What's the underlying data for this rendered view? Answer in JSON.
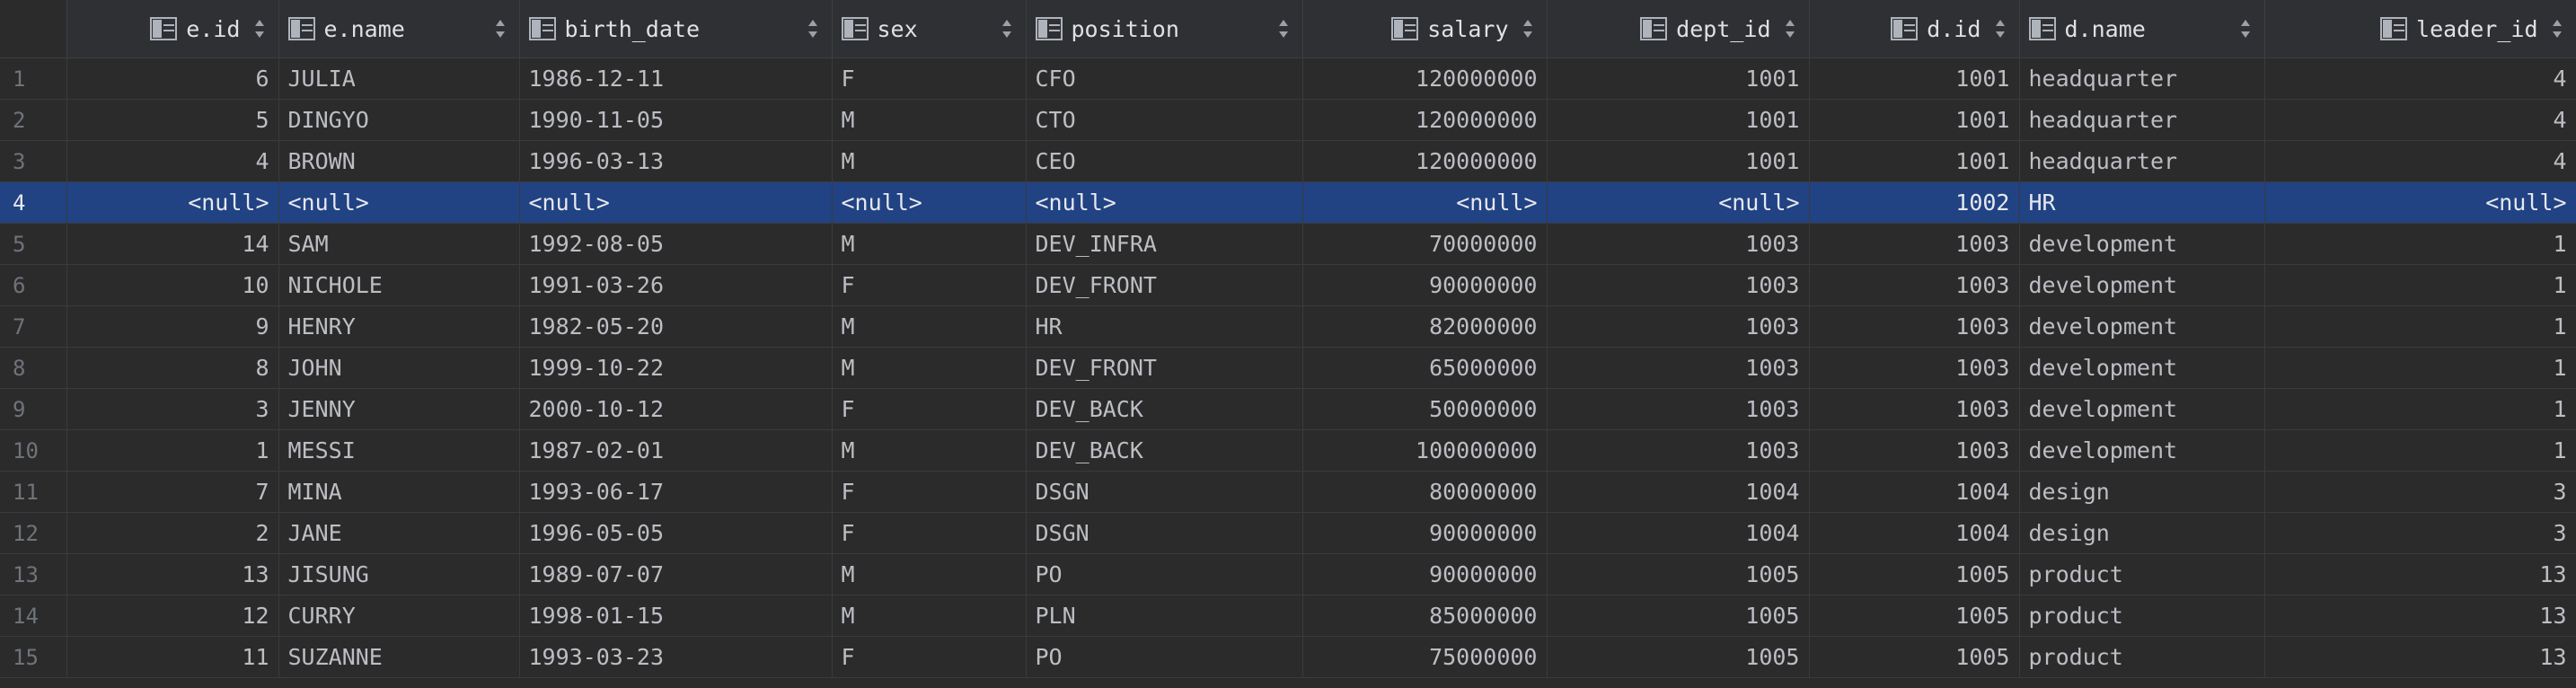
{
  "columns": [
    {
      "label": "e.id",
      "align": "right"
    },
    {
      "label": "e.name",
      "align": "left"
    },
    {
      "label": "birth_date",
      "align": "left"
    },
    {
      "label": "sex",
      "align": "left"
    },
    {
      "label": "position",
      "align": "left"
    },
    {
      "label": "salary",
      "align": "right"
    },
    {
      "label": "dept_id",
      "align": "right"
    },
    {
      "label": "d.id",
      "align": "right"
    },
    {
      "label": "d.name",
      "align": "left"
    },
    {
      "label": "leader_id",
      "align": "right"
    }
  ],
  "selected_row": 4,
  "rows": [
    {
      "n": "1",
      "cells": [
        "6",
        "JULIA",
        "1986-12-11",
        "F",
        "CFO",
        "120000000",
        "1001",
        "1001",
        "headquarter",
        "4"
      ]
    },
    {
      "n": "2",
      "cells": [
        "5",
        "DINGYO",
        "1990-11-05",
        "M",
        "CTO",
        "120000000",
        "1001",
        "1001",
        "headquarter",
        "4"
      ]
    },
    {
      "n": "3",
      "cells": [
        "4",
        "BROWN",
        "1996-03-13",
        "M",
        "CEO",
        "120000000",
        "1001",
        "1001",
        "headquarter",
        "4"
      ]
    },
    {
      "n": "4",
      "cells": [
        "<null>",
        "<null>",
        "<null>",
        "<null>",
        "<null>",
        "<null>",
        "<null>",
        "1002",
        "HR",
        "<null>"
      ]
    },
    {
      "n": "5",
      "cells": [
        "14",
        "SAM",
        "1992-08-05",
        "M",
        "DEV_INFRA",
        "70000000",
        "1003",
        "1003",
        "development",
        "1"
      ]
    },
    {
      "n": "6",
      "cells": [
        "10",
        "NICHOLE",
        "1991-03-26",
        "F",
        "DEV_FRONT",
        "90000000",
        "1003",
        "1003",
        "development",
        "1"
      ]
    },
    {
      "n": "7",
      "cells": [
        "9",
        "HENRY",
        "1982-05-20",
        "M",
        "HR",
        "82000000",
        "1003",
        "1003",
        "development",
        "1"
      ]
    },
    {
      "n": "8",
      "cells": [
        "8",
        "JOHN",
        "1999-10-22",
        "M",
        "DEV_FRONT",
        "65000000",
        "1003",
        "1003",
        "development",
        "1"
      ]
    },
    {
      "n": "9",
      "cells": [
        "3",
        "JENNY",
        "2000-10-12",
        "F",
        "DEV_BACK",
        "50000000",
        "1003",
        "1003",
        "development",
        "1"
      ]
    },
    {
      "n": "10",
      "cells": [
        "1",
        "MESSI",
        "1987-02-01",
        "M",
        "DEV_BACK",
        "100000000",
        "1003",
        "1003",
        "development",
        "1"
      ]
    },
    {
      "n": "11",
      "cells": [
        "7",
        "MINA",
        "1993-06-17",
        "F",
        "DSGN",
        "80000000",
        "1004",
        "1004",
        "design",
        "3"
      ]
    },
    {
      "n": "12",
      "cells": [
        "2",
        "JANE",
        "1996-05-05",
        "F",
        "DSGN",
        "90000000",
        "1004",
        "1004",
        "design",
        "3"
      ]
    },
    {
      "n": "13",
      "cells": [
        "13",
        "JISUNG",
        "1989-07-07",
        "M",
        "PO",
        "90000000",
        "1005",
        "1005",
        "product",
        "13"
      ]
    },
    {
      "n": "14",
      "cells": [
        "12",
        "CURRY",
        "1998-01-15",
        "M",
        "PLN",
        "85000000",
        "1005",
        "1005",
        "product",
        "13"
      ]
    },
    {
      "n": "15",
      "cells": [
        "11",
        "SUZANNE",
        "1993-03-23",
        "F",
        "PO",
        "75000000",
        "1005",
        "1005",
        "product",
        "13"
      ]
    }
  ],
  "icons": {
    "column": "table-column-icon",
    "sort": "sort-arrows-icon"
  },
  "colors": {
    "selection": "#214283",
    "background": "#2b2b2b",
    "header": "#2f3033"
  }
}
